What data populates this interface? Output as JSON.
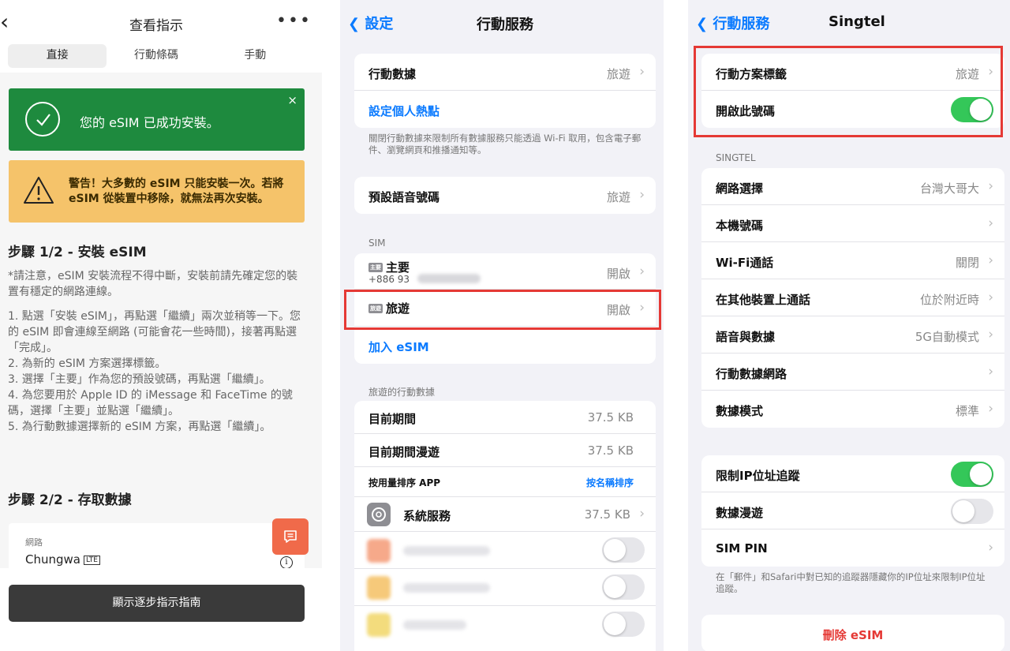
{
  "panel1": {
    "title": "查看指示",
    "back": "‹",
    "more": "•••",
    "tabs": [
      "直接",
      "行動條碼",
      "手動"
    ],
    "success_msg": "您的 eSIM 已成功安裝。",
    "success_close": "×",
    "warning": "警告！大多數的 eSIM 只能安裝一次。若將 eSIM 從裝置中移除，就無法再次安裝。",
    "step1_title": "步驟 1/2 - 安裝 eSIM",
    "note": "*請注意，eSIM 安裝流程不得中斷，安裝前請先確定您的裝置有穩定的網路連線。",
    "steps": [
      "1. 點選「安裝 eSIM」，再點選「繼續」兩次並稍等一下。您的 eSIM 即會連線至網路 (可能會花一些時間)，接著再點選「完成」。",
      "2. 為新的 eSIM 方案選擇標籤。",
      "3. 選擇「主要」作為您的預設號碼，再點選「繼續」。",
      "4. 為您要用於 Apple ID 的 iMessage 和 FaceTime 的號碼，選擇「主要」並點選「繼續」。",
      "5. 為行動數據選擇新的 eSIM 方案，再點選「繼續」。"
    ],
    "step2_title": "步驟 2/2 - 存取數據",
    "network_label": "網路",
    "network_value": "Chungwa",
    "network_badge": "LTE",
    "info": "i",
    "guide_button": "顯示逐步指示指南"
  },
  "panel2": {
    "back": "設定",
    "title": "行動服務",
    "cellular_data": {
      "label": "行動數據",
      "value": "旅遊"
    },
    "hotspot": "設定個人熱點",
    "data_note": "關閉行動數據來限制所有數據服務只能透過 Wi-Fi 取用，包含電子郵件、瀏覽網頁和推播通知等。",
    "default_voice": {
      "label": "預設語音號碼",
      "value": "旅遊"
    },
    "sim_header": "SIM",
    "sim_primary": {
      "badge": "主要",
      "label": "主要",
      "number": "+886 93",
      "value": "開啟"
    },
    "sim_travel": {
      "badge": "旅遊",
      "label": "旅遊",
      "value": "開啟"
    },
    "add_esim": "加入 eSIM",
    "usage_header": "旅遊的行動數據",
    "current_period": {
      "label": "目前期間",
      "value": "37.5 KB"
    },
    "current_roaming": {
      "label": "目前期間漫遊",
      "value": "37.5 KB"
    },
    "sort_label": "按用量排序 APP",
    "sort_link": "按名稱排序",
    "system_services": {
      "label": "系統服務",
      "value": "37.5 KB"
    }
  },
  "panel3": {
    "back": "行動服務",
    "title": "Singtel",
    "plan_label": {
      "label": "行動方案標籤",
      "value": "旅遊"
    },
    "turn_on": "開啟此號碼",
    "section": "SINGTEL",
    "rows": [
      {
        "label": "網路選擇",
        "value": "台灣大哥大"
      },
      {
        "label": "本機號碼",
        "value": ""
      },
      {
        "label": "Wi-Fi通話",
        "value": "關閉"
      },
      {
        "label": "在其他裝置上通話",
        "value": "位於附近時"
      },
      {
        "label": "語音與數據",
        "value": "5G自動模式"
      },
      {
        "label": "行動數據網路",
        "value": ""
      },
      {
        "label": "數據模式",
        "value": "標準"
      }
    ],
    "limit_ip": "限制IP位址追蹤",
    "data_roaming": "數據漫遊",
    "sim_pin": "SIM PIN",
    "ip_note": "在「郵件」和Safari中對已知的追蹤器隱藏你的IP位址來限制IP位址追蹤。",
    "delete": "刪除 eSIM"
  },
  "colors": {
    "ios_blue": "#0a7aff",
    "switch_on": "#34c759",
    "success": "#1e8a3e",
    "warning": "#f5c36a",
    "highlight": "#e53935"
  }
}
